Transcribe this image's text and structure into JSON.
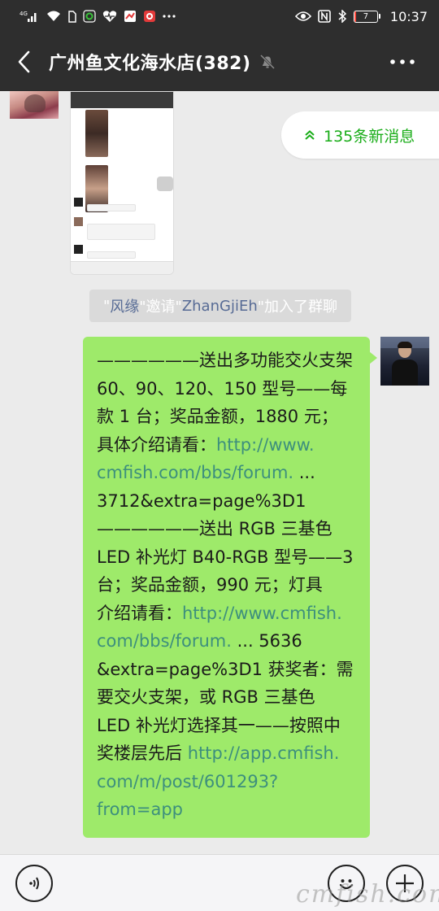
{
  "status_bar": {
    "network": "4G",
    "battery_level": "7",
    "time": "10:37",
    "colors": {
      "bar_bg": "#2e2e2e",
      "battery_low": "#ff4b3e"
    },
    "left_icons": [
      "cellular-signal-icon",
      "wifi-icon",
      "sim-card-icon",
      "green-app-notification-icon",
      "heart-rate-app-icon",
      "red-app-notification-icon",
      "red-app-notification-icon-2",
      "more-notifications-icon"
    ],
    "right_icons": [
      "eye-comfort-icon",
      "nfc-icon",
      "bluetooth-icon",
      "battery-icon"
    ]
  },
  "nav_bar": {
    "title": "广州鱼文化海水店(382)",
    "icons": {
      "back": "chevron-left-icon",
      "mute": "bell-muted-icon",
      "more": "more-dots-icon"
    }
  },
  "new_messages": {
    "label": "135条新消息",
    "icon": "double-chevron-up-icon",
    "color": "#1aad19"
  },
  "system_notice": {
    "open_quote": "\"",
    "inviter": "风缘",
    "mid": "\"邀请\"",
    "invitee": "ZhanGjiEh",
    "tail": "\"加入了群聊"
  },
  "message": {
    "bubble_color": "#9eea6a",
    "link_color": "#3d8f7d",
    "lines": [
      {
        "parts": [
          {
            "text": "——————送出多功能交火支架"
          }
        ]
      },
      {
        "parts": [
          {
            "text": "60、90、120、150 型号——每"
          }
        ]
      },
      {
        "parts": [
          {
            "text": "款 1 台；奖品金额，1880 元；"
          }
        ]
      },
      {
        "parts": [
          {
            "text": "具体介绍请看："
          },
          {
            "text": "http://www.",
            "link": true
          }
        ]
      },
      {
        "parts": [
          {
            "text": "cmfish.com/bbs/forum.",
            "link": true
          },
          {
            "text": " ..."
          }
        ]
      },
      {
        "parts": [
          {
            "text": "3712&extra=page%3D1"
          }
        ]
      },
      {
        "parts": [
          {
            "text": "——————送出 RGB 三基色"
          }
        ]
      },
      {
        "parts": [
          {
            "text": "LED 补光灯 B40-RGB 型号——3"
          }
        ]
      },
      {
        "parts": [
          {
            "text": "台；奖品金额，990 元；灯具"
          }
        ]
      },
      {
        "parts": [
          {
            "text": "介绍请看："
          },
          {
            "text": "http://www.cmfish.",
            "link": true
          }
        ]
      },
      {
        "parts": [
          {
            "text": "com/bbs/forum.",
            "link": true
          },
          {
            "text": " ... 5636"
          }
        ]
      },
      {
        "parts": [
          {
            "text": "&extra=page%3D1 获奖者：需"
          }
        ]
      },
      {
        "parts": [
          {
            "text": "要交火支架，或 RGB 三基色"
          }
        ]
      },
      {
        "parts": [
          {
            "text": "LED 补光灯选择其一——按照中"
          }
        ]
      },
      {
        "parts": [
          {
            "text": "奖楼层先后 "
          },
          {
            "text": "http://app.cmfish.",
            "link": true
          }
        ]
      },
      {
        "parts": [
          {
            "text": "com/m/post/601293?",
            "link": true
          }
        ]
      },
      {
        "parts": [
          {
            "text": "from=app",
            "link": true
          }
        ]
      }
    ]
  },
  "input_bar": {
    "placeholder": "",
    "icons": {
      "voice": "voice-icon",
      "emoji": "emoji-icon",
      "plus": "plus-icon"
    }
  },
  "watermark": "cmfish.com"
}
